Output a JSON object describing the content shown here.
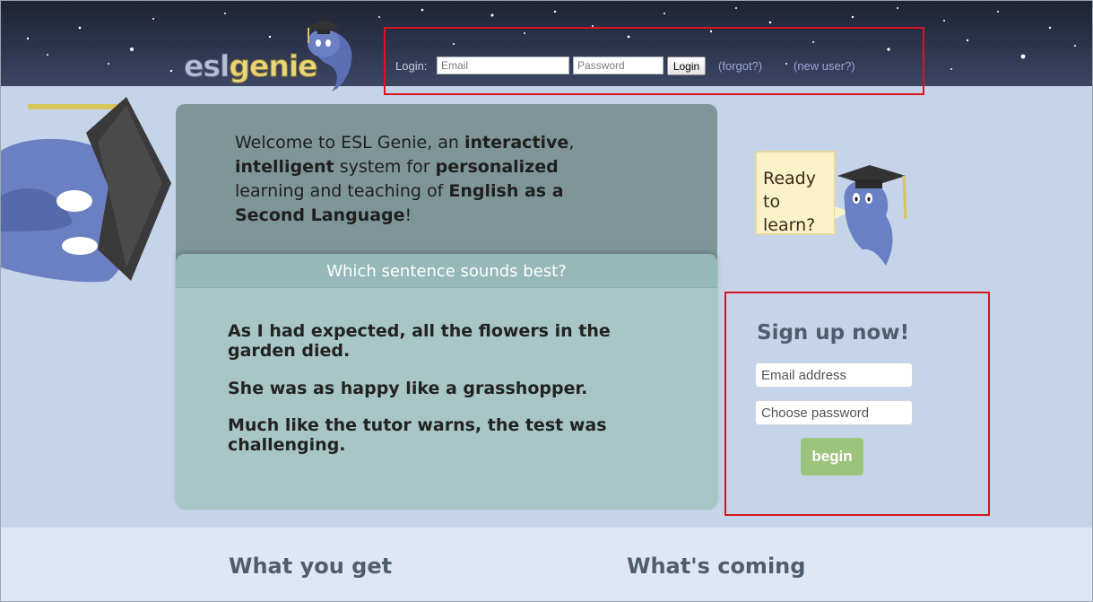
{
  "header": {
    "logo": {
      "part1": "esl",
      "part2": "genie"
    },
    "login_label": "Login:",
    "email_placeholder": "Email",
    "password_placeholder": "Password",
    "login_button": "Login",
    "forgot_link": "(forgot?)",
    "new_user_link": "(new user?)"
  },
  "welcome": {
    "t1": "Welcome to ESL Genie, an ",
    "b1": "interactive",
    "t2": ", ",
    "b2": "intelligent",
    "t3": " system for ",
    "b3": "personalized",
    "t4": " learning and teaching of ",
    "b4": "English as a Second Language",
    "t5": "!"
  },
  "quiz": {
    "title": "Which sentence sounds best?",
    "sentences": [
      "As I had expected, all the flowers in the garden died.",
      "She was as happy like a grasshopper.",
      "Much like the tutor warns, the test was challenging."
    ]
  },
  "mascot": {
    "note": "Ready to learn?"
  },
  "signup": {
    "title": "Sign up now!",
    "email_placeholder": "Email address",
    "password_placeholder": "Choose password",
    "button": "begin"
  },
  "bottom": {
    "left_heading": "What you get",
    "right_heading": "What's coming"
  },
  "colors": {
    "page_bg": "#c6d4ea",
    "header_bg": "#2a3149",
    "welcome_panel": "#7f9698",
    "quiz_panel": "#a8c6c6",
    "highlight_border": "#d6161d",
    "begin_button": "#9bc47c"
  }
}
